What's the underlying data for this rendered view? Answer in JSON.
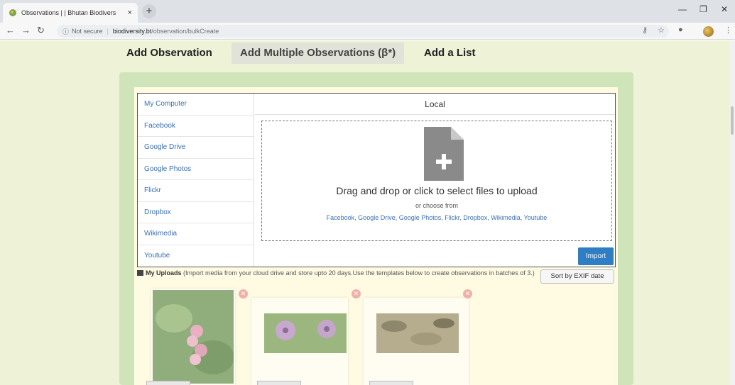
{
  "browser": {
    "tab_title": "Observations | | Bhutan Biodivers",
    "tab_close": "×",
    "new_tab": "+",
    "security": "Not secure",
    "url_domain": "biodiversity.bt",
    "url_path": "/observation/bulkCreate"
  },
  "tabs": {
    "add_observation": "Add Observation",
    "add_multiple": "Add Multiple Observations (β*)",
    "add_list": "Add a List"
  },
  "sources": [
    "My Computer",
    "Facebook",
    "Google Drive",
    "Google Photos",
    "Flickr",
    "Dropbox",
    "Wikimedia",
    "Youtube"
  ],
  "uploader": {
    "title": "Local",
    "drop_main": "Drag and drop or click to select files to upload",
    "drop_sub": "or choose from",
    "drop_links": "Facebook, Google Drive, Google Photos, Flickr, Dropbox, Wikimedia, Youtube",
    "import_label": "Import"
  },
  "my_uploads": {
    "heading": "My Uploads",
    "description": " (Import media from your cloud drive and store upto 20 days.Use the templates below to create observations in batches of 3.)",
    "sort_label": "Sort by EXIF date"
  },
  "colors": {
    "page_bg": "#eef3d8",
    "panel": "#cfe5b9",
    "link": "#3a6fb0",
    "button": "#2f7dc2"
  }
}
